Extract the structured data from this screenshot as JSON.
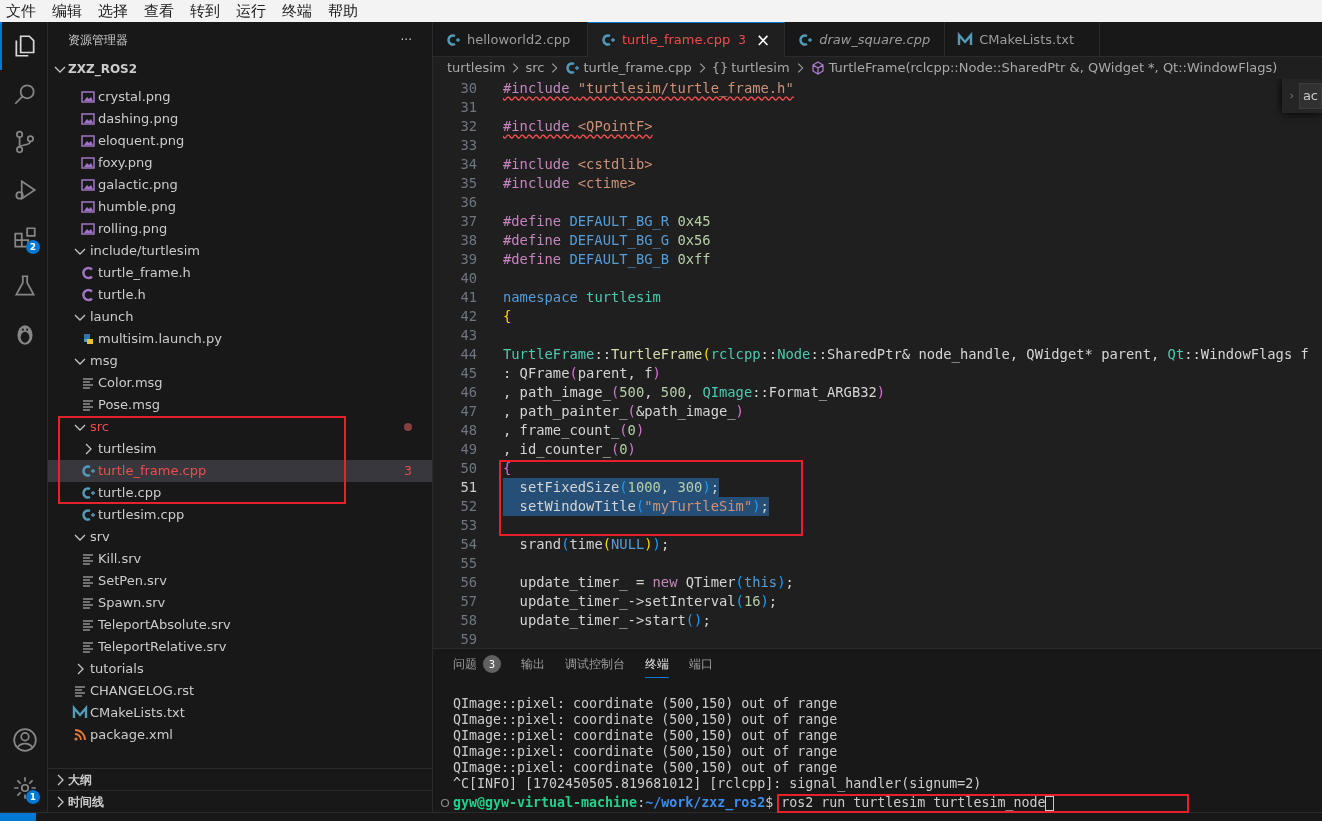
{
  "menu": [
    "文件",
    "编辑",
    "选择",
    "查看",
    "转到",
    "运行",
    "终端",
    "帮助"
  ],
  "activity_bar": [
    {
      "kind": "explorer",
      "selected": true
    },
    {
      "kind": "search",
      "selected": false
    },
    {
      "kind": "source-control",
      "selected": false
    },
    {
      "kind": "run-debug",
      "selected": false
    },
    {
      "kind": "extensions",
      "selected": false,
      "badge": "2"
    },
    {
      "kind": "testing",
      "selected": false
    },
    {
      "kind": "penguin",
      "selected": false
    }
  ],
  "activity_bottom": [
    {
      "kind": "account"
    },
    {
      "kind": "settings",
      "badge": "1"
    }
  ],
  "sidebar": {
    "title": "资源管理器",
    "more": "···",
    "root": {
      "label": "ZXZ_ROS2",
      "expanded": true,
      "children": [
        {
          "kind": "offscreen-folder",
          "children": [
            {
              "kind": "image",
              "label": "crystal.png"
            },
            {
              "kind": "image",
              "label": "dashing.png"
            },
            {
              "kind": "image",
              "label": "eloquent.png"
            },
            {
              "kind": "image",
              "label": "foxy.png"
            },
            {
              "kind": "image",
              "label": "galactic.png"
            },
            {
              "kind": "image",
              "label": "humble.png"
            },
            {
              "kind": "image",
              "label": "rolling.png"
            }
          ]
        },
        {
          "kind": "folder",
          "label": "include/turtlesim",
          "expanded": true,
          "children": [
            {
              "kind": "c-header",
              "label": "turtle_frame.h"
            },
            {
              "kind": "c-header",
              "label": "turtle.h"
            }
          ]
        },
        {
          "kind": "folder",
          "label": "launch",
          "expanded": true,
          "children": [
            {
              "kind": "python",
              "label": "multisim.launch.py"
            }
          ]
        },
        {
          "kind": "folder",
          "label": "msg",
          "expanded": true,
          "children": [
            {
              "kind": "text",
              "label": "Color.msg"
            },
            {
              "kind": "text",
              "label": "Pose.msg"
            }
          ]
        },
        {
          "kind": "folder",
          "label": "src",
          "expanded": true,
          "has_errors": true,
          "boxed": true,
          "children": [
            {
              "kind": "folder",
              "label": "turtlesim",
              "expanded": false,
              "boxed": true
            },
            {
              "kind": "cpp",
              "label": "turtle_frame.cpp",
              "selected": true,
              "has_errors": true,
              "errors": "3",
              "boxed": true
            },
            {
              "kind": "cpp",
              "label": "turtle.cpp",
              "boxed": true
            },
            {
              "kind": "cpp",
              "label": "turtlesim.cpp"
            }
          ]
        },
        {
          "kind": "folder",
          "label": "srv",
          "expanded": true,
          "children": [
            {
              "kind": "text",
              "label": "Kill.srv"
            },
            {
              "kind": "text",
              "label": "SetPen.srv"
            },
            {
              "kind": "text",
              "label": "Spawn.srv"
            },
            {
              "kind": "text",
              "label": "TeleportAbsolute.srv"
            },
            {
              "kind": "text",
              "label": "TeleportRelative.srv"
            }
          ]
        },
        {
          "kind": "folder",
          "label": "tutorials",
          "expanded": false
        },
        {
          "kind": "text",
          "label": "CHANGELOG.rst"
        },
        {
          "kind": "cmake",
          "label": "CMakeLists.txt"
        },
        {
          "kind": "xml",
          "label": "package.xml"
        }
      ]
    },
    "sections": [
      {
        "label": "大纲",
        "expanded": false
      },
      {
        "label": "时间线",
        "expanded": false
      }
    ]
  },
  "tabs": [
    {
      "kind": "cpp",
      "label": "helloworld2.cpp",
      "selected": false,
      "preview": false
    },
    {
      "kind": "cpp",
      "label": "turtle_frame.cpp",
      "selected": true,
      "preview": false,
      "has_errors": true,
      "errors": "3",
      "close": "×"
    },
    {
      "kind": "cpp",
      "label": "draw_square.cpp",
      "selected": false,
      "preview": true
    },
    {
      "kind": "cmake",
      "label": "CMakeLists.txt",
      "selected": false,
      "preview": false
    }
  ],
  "breadcrumb": [
    {
      "kind": "folder",
      "text": "turtlesim"
    },
    {
      "kind": "folder",
      "text": "src"
    },
    {
      "kind": "cpp",
      "text": "turtle_frame.cpp"
    },
    {
      "kind": "namespace",
      "symbol": "{}",
      "text": "turtlesim"
    },
    {
      "kind": "method",
      "text": "TurtleFrame(rclcpp::Node::SharedPtr &, QWidget *, Qt::WindowFlags)"
    }
  ],
  "find_widget": {
    "value": "ac"
  },
  "code": [
    {
      "number": "30",
      "squiggle": true,
      "tokens": [
        {
          "text": "#include ",
          "kind": "pp"
        },
        {
          "text": "\"turtlesim/turtle_frame.h\"",
          "kind": "str"
        }
      ]
    },
    {
      "number": "31"
    },
    {
      "number": "32",
      "squiggle": true,
      "tokens": [
        {
          "text": "#include ",
          "kind": "pp"
        },
        {
          "text": "<QPointF>",
          "kind": "str"
        }
      ]
    },
    {
      "number": "33"
    },
    {
      "number": "34",
      "tokens": [
        {
          "text": "#include ",
          "kind": "pp"
        },
        {
          "text": "<cstdlib>",
          "kind": "str"
        }
      ]
    },
    {
      "number": "35",
      "tokens": [
        {
          "text": "#include ",
          "kind": "pp"
        },
        {
          "text": "<ctime>",
          "kind": "str"
        }
      ]
    },
    {
      "number": "36"
    },
    {
      "number": "37",
      "tokens": [
        {
          "text": "#define ",
          "kind": "pp"
        },
        {
          "text": "DEFAULT_BG_R ",
          "kind": "macro"
        },
        {
          "text": "0x45",
          "kind": "num"
        }
      ]
    },
    {
      "number": "38",
      "tokens": [
        {
          "text": "#define ",
          "kind": "pp"
        },
        {
          "text": "DEFAULT_BG_G ",
          "kind": "macro"
        },
        {
          "text": "0x56",
          "kind": "num"
        }
      ]
    },
    {
      "number": "39",
      "tokens": [
        {
          "text": "#define ",
          "kind": "pp"
        },
        {
          "text": "DEFAULT_BG_B ",
          "kind": "macro"
        },
        {
          "text": "0xff",
          "kind": "num"
        }
      ]
    },
    {
      "number": "40"
    },
    {
      "number": "41",
      "tokens": [
        {
          "text": "namespace ",
          "kind": "kw"
        },
        {
          "text": "turtlesim",
          "kind": "type"
        }
      ]
    },
    {
      "number": "42",
      "tokens": [
        {
          "text": "{",
          "kind": "b1"
        }
      ]
    },
    {
      "number": "43"
    },
    {
      "number": "44",
      "tokens": [
        {
          "text": "TurtleFrame",
          "kind": "type"
        },
        {
          "text": "::",
          "kind": "p"
        },
        {
          "text": "TurtleFrame",
          "kind": "fn"
        },
        {
          "text": "(",
          "kind": "b1"
        },
        {
          "text": "rclcpp",
          "kind": "type"
        },
        {
          "text": "::",
          "kind": "p"
        },
        {
          "text": "Node",
          "kind": "type"
        },
        {
          "text": "::",
          "kind": "p"
        },
        {
          "text": "SharedPtr& node_handle, QWidget* parent, ",
          "kind": "p"
        },
        {
          "text": "Qt",
          "kind": "type"
        },
        {
          "text": "::",
          "kind": "p"
        },
        {
          "text": "WindowFlags f",
          "kind": "p"
        }
      ]
    },
    {
      "number": "45",
      "tokens": [
        {
          "text": ": QFrame",
          "kind": "p"
        },
        {
          "text": "(",
          "kind": "b2"
        },
        {
          "text": "parent, f",
          "kind": "p"
        },
        {
          "text": ")",
          "kind": "b2"
        }
      ]
    },
    {
      "number": "46",
      "tokens": [
        {
          "text": ", path_image_",
          "kind": "p"
        },
        {
          "text": "(",
          "kind": "b2"
        },
        {
          "text": "500",
          "kind": "num"
        },
        {
          "text": ", ",
          "kind": "p"
        },
        {
          "text": "500",
          "kind": "num"
        },
        {
          "text": ", ",
          "kind": "p"
        },
        {
          "text": "QImage",
          "kind": "type"
        },
        {
          "text": "::Format_ARGB32",
          "kind": "p"
        },
        {
          "text": ")",
          "kind": "b2"
        }
      ]
    },
    {
      "number": "47",
      "tokens": [
        {
          "text": ", path_painter_",
          "kind": "p"
        },
        {
          "text": "(",
          "kind": "b2"
        },
        {
          "text": "&path_image_",
          "kind": "p"
        },
        {
          "text": ")",
          "kind": "b2"
        }
      ]
    },
    {
      "number": "48",
      "tokens": [
        {
          "text": ", frame_count_",
          "kind": "p"
        },
        {
          "text": "(",
          "kind": "b2"
        },
        {
          "text": "0",
          "kind": "num"
        },
        {
          "text": ")",
          "kind": "b2"
        }
      ]
    },
    {
      "number": "49",
      "tokens": [
        {
          "text": ", id_counter_",
          "kind": "p"
        },
        {
          "text": "(",
          "kind": "b2"
        },
        {
          "text": "0",
          "kind": "num"
        },
        {
          "text": ")",
          "kind": "b2"
        }
      ]
    },
    {
      "number": "50",
      "boxed": true,
      "tokens": [
        {
          "text": "{",
          "kind": "b2"
        }
      ]
    },
    {
      "number": "51",
      "boxed": true,
      "current": true,
      "selected": true,
      "tokens": [
        {
          "text": "  setFixedSize",
          "kind": "p"
        },
        {
          "text": "(",
          "kind": "b3"
        },
        {
          "text": "1000",
          "kind": "num"
        },
        {
          "text": ", ",
          "kind": "p"
        },
        {
          "text": "300",
          "kind": "num"
        },
        {
          "text": ")",
          "kind": "b3"
        },
        {
          "text": ";",
          "kind": "p"
        }
      ]
    },
    {
      "number": "52",
      "boxed": true,
      "selected": true,
      "tokens": [
        {
          "text": "  setWindowTitle",
          "kind": "p"
        },
        {
          "text": "(",
          "kind": "b3"
        },
        {
          "text": "\"myTurtleSim\"",
          "kind": "str"
        },
        {
          "text": ")",
          "kind": "b3"
        },
        {
          "text": ";",
          "kind": "p"
        }
      ]
    },
    {
      "number": "53",
      "boxed": true
    },
    {
      "number": "54",
      "tokens": [
        {
          "text": "  srand",
          "kind": "p"
        },
        {
          "text": "(",
          "kind": "b3"
        },
        {
          "text": "time",
          "kind": "p"
        },
        {
          "text": "(",
          "kind": "b1"
        },
        {
          "text": "NULL",
          "kind": "kw"
        },
        {
          "text": ")",
          "kind": "b1"
        },
        {
          "text": ")",
          "kind": "b3"
        },
        {
          "text": ";",
          "kind": "p"
        }
      ]
    },
    {
      "number": "55"
    },
    {
      "number": "56",
      "tokens": [
        {
          "text": "  update_timer_ = ",
          "kind": "p"
        },
        {
          "text": "new",
          "kind": "kwc"
        },
        {
          "text": " QTimer",
          "kind": "p"
        },
        {
          "text": "(",
          "kind": "b3"
        },
        {
          "text": "this",
          "kind": "kw"
        },
        {
          "text": ")",
          "kind": "b3"
        },
        {
          "text": ";",
          "kind": "p"
        }
      ]
    },
    {
      "number": "57",
      "tokens": [
        {
          "text": "  update_timer_->setInterval",
          "kind": "p"
        },
        {
          "text": "(",
          "kind": "b3"
        },
        {
          "text": "16",
          "kind": "num"
        },
        {
          "text": ")",
          "kind": "b3"
        },
        {
          "text": ";",
          "kind": "p"
        }
      ]
    },
    {
      "number": "58",
      "tokens": [
        {
          "text": "  update_timer_->start",
          "kind": "p"
        },
        {
          "text": "(",
          "kind": "b3"
        },
        {
          "text": ")",
          "kind": "b3"
        },
        {
          "text": ";",
          "kind": "p"
        }
      ]
    },
    {
      "number": "59"
    }
  ],
  "panel": {
    "tabs": [
      {
        "label": "问题",
        "badge": "3",
        "selected": false
      },
      {
        "label": "输出",
        "selected": false
      },
      {
        "label": "调试控制台",
        "selected": false
      },
      {
        "label": "终端",
        "selected": true
      },
      {
        "label": "端口",
        "selected": false
      }
    ],
    "terminal": {
      "lines": [
        "QImage::pixel: coordinate (500,150) out of range",
        "QImage::pixel: coordinate (500,150) out of range",
        "QImage::pixel: coordinate (500,150) out of range",
        "QImage::pixel: coordinate (500,150) out of range",
        "QImage::pixel: coordinate (500,150) out of range",
        "^C[INFO] [1702450505.819681012] [rclcpp]: signal_handler(signum=2)"
      ],
      "prompt": {
        "user": "gyw@gyw-virtual-machine",
        "separator": ":",
        "path": "~/work/zxz_ros2",
        "symbol": "$",
        "command": "ros2 run turtlesim turtlesim_node",
        "boxed": true
      }
    }
  }
}
